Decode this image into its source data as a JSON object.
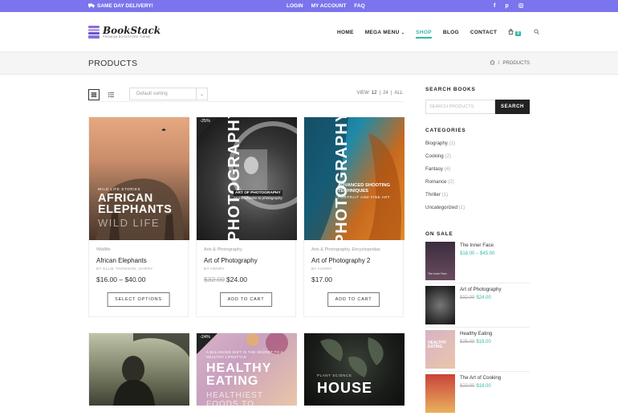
{
  "topbar": {
    "promo": "SAME DAY DELIVERY!",
    "links": [
      "LOGIN",
      "MY ACCOUNT",
      "FAQ"
    ],
    "social_icons": [
      "facebook-icon",
      "pinterest-icon",
      "instagram-icon"
    ],
    "bg": "#7b74ec"
  },
  "logo": {
    "name": "BookStack",
    "tagline": "PREMIUM BOOKSTORE THEME"
  },
  "nav": {
    "items": [
      "HOME",
      "MEGA MENU",
      "SHOP",
      "BLOG",
      "CONTACT"
    ],
    "active": "SHOP",
    "cart_count": "0",
    "accent": "#33b8a5"
  },
  "page": {
    "title": "PRODUCTS",
    "breadcrumb": "PRODUCTS"
  },
  "toolbar": {
    "sort_placeholder": "Default sorting",
    "view_label": "VIEW",
    "view_options": [
      "12",
      "24",
      "ALL"
    ]
  },
  "products": [
    {
      "category": "Wildlife",
      "title": "African Elephants",
      "author": "BY ELLIE THOMSON, HARRY",
      "price": "$16.00 – $40.00",
      "old_price": "",
      "button": "SELECT OPTIONS",
      "sale": "",
      "cover_small": "WILD LIFE STORIES",
      "cover_title": "AFRICAN ELEPHANTS",
      "cover_sub": "WILD LIFE"
    },
    {
      "category": "Arts & Photography",
      "title": "Art of Photography",
      "author": "BY HENRY",
      "price": "$24.00",
      "old_price": "$32.00",
      "button": "ADD TO CART",
      "sale": "-25%",
      "cover_title": "PHOTOGRAPHY",
      "cover_sub": "ART OF PHOTOGRAPHY",
      "cover_small": "an introduction to photography"
    },
    {
      "category": "Arts & Photography, Encyclopedias",
      "title": "Art of Photography 2",
      "author": "BY HARRY",
      "price": "$17.00",
      "old_price": "",
      "button": "ADD TO CART",
      "sale": "",
      "cover_title": "PHOTOGRAPHY",
      "cover_sub": "ADVANCED SHOOTING TECHNIQUES",
      "cover_small": "PORTRAIT AND FINE ART"
    },
    {
      "category": "",
      "title": "",
      "author": "",
      "price": "",
      "old_price": "",
      "button": "",
      "sale": "",
      "cover_title": "",
      "cover_sub": "",
      "cover_small": ""
    },
    {
      "category": "",
      "title": "",
      "author": "",
      "price": "",
      "old_price": "",
      "button": "",
      "sale": "-24%",
      "cover_title": "HEALTHY EATING",
      "cover_sub": "HEALTHIEST FOODS TO",
      "cover_small": "A BALANCED DIET IS THE SECRET TO A HEALTHY LIFESTYLE"
    },
    {
      "category": "",
      "title": "",
      "author": "",
      "price": "",
      "old_price": "",
      "button": "",
      "sale": "",
      "cover_title": "HOUSE",
      "cover_sub": "",
      "cover_small": "PLANT SCIENCE"
    }
  ],
  "sidebar": {
    "search_title": "SEARCH BOOKS",
    "search_placeholder": "SEARCH PRODUCTS",
    "search_button": "SEARCH",
    "categories_title": "CATEGORIES",
    "categories": [
      {
        "name": "Biography",
        "count": "(1)"
      },
      {
        "name": "Cooking",
        "count": "(2)"
      },
      {
        "name": "Fantasy",
        "count": "(4)"
      },
      {
        "name": "Romance",
        "count": "(2)"
      },
      {
        "name": "Thriller",
        "count": "(1)"
      },
      {
        "name": "Uncategorized",
        "count": "(1)"
      }
    ],
    "onsale_title": "ON SALE",
    "onsale": [
      {
        "title": "The Inner Face",
        "old": "",
        "price": "$18.00 – $45.00",
        "thumb_text": "The Inner Face"
      },
      {
        "title": "Art of Photography",
        "old": "$32.00",
        "price": "$24.00",
        "thumb_text": ""
      },
      {
        "title": "Healthy Eating",
        "old": "$25.00",
        "price": "$19.00",
        "thumb_text": "HEALTHY EATING"
      },
      {
        "title": "The Art of Cooking",
        "old": "$22.00",
        "price": "$18.00",
        "thumb_text": ""
      }
    ]
  }
}
